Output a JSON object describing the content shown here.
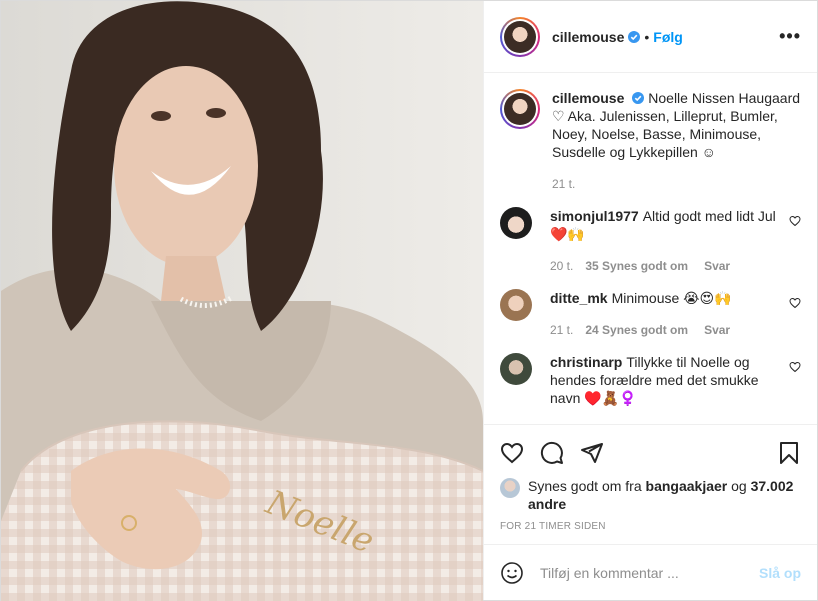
{
  "post": {
    "username": "cillemouse",
    "follow_label": "Følg",
    "dot": "•",
    "more_label": "•••"
  },
  "caption": {
    "username": "cillemouse",
    "text": "Noelle Nissen Haugaard ♡ Aka. Julenissen, Lilleprut, Bumler, Noey, Noelse, Basse, Minimouse, Susdelle og Lykkepillen ☺",
    "time": "21 t."
  },
  "comments": [
    {
      "username": "simonjul1977",
      "text": "Altid godt med lidt Jul ❤️🙌",
      "time": "20 t.",
      "likes": "35 Synes godt om",
      "reply": "Svar"
    },
    {
      "username": "ditte_mk",
      "text": "Minimouse 😭😍🙌",
      "time": "21 t.",
      "likes": "24 Synes godt om",
      "reply": "Svar"
    },
    {
      "username": "christinarp",
      "text": "Tillykke til Noelle og hendes forældre med det smukke navn ♥️🧸♀️",
      "time": "",
      "likes": "",
      "reply": ""
    }
  ],
  "likes": {
    "prefix": "Synes godt om fra",
    "user": "bangaakjaer",
    "joiner": "og",
    "count": "37.002 andre"
  },
  "timestamp": "FOR 21 TIMER SIDEN",
  "add_comment": {
    "placeholder": "Tilføj en kommentar ...",
    "post_label": "Slå op"
  },
  "photo": {
    "pillow_text": "Noelle"
  },
  "colors": {
    "link": "#0095f6",
    "verified": "#3897f0",
    "post_disabled": "#b2dffc",
    "meta": "#8e8e8e"
  }
}
